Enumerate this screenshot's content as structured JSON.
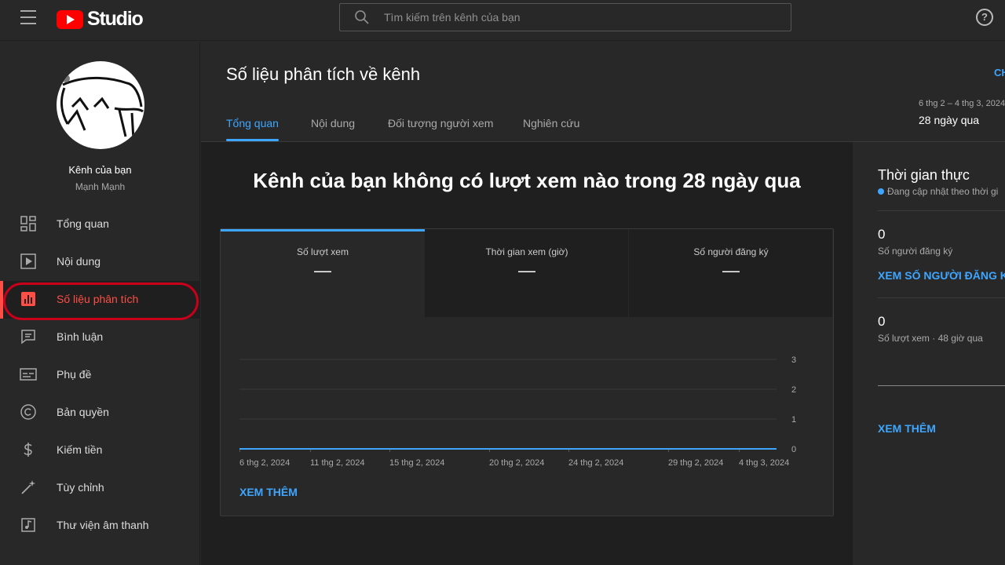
{
  "header": {
    "logo_text": "Studio",
    "search_placeholder": "Tìm kiếm trên kênh của bạn",
    "help_label": "?"
  },
  "sidebar": {
    "channel_name": "Kênh của bạn",
    "channel_owner": "Mạnh Mạnh",
    "items": [
      {
        "label": "Tổng quan",
        "icon": "dashboard-icon"
      },
      {
        "label": "Nội dung",
        "icon": "content-icon"
      },
      {
        "label": "Số liệu phân tích",
        "icon": "analytics-icon",
        "active": true
      },
      {
        "label": "Bình luận",
        "icon": "comments-icon"
      },
      {
        "label": "Phụ đề",
        "icon": "subtitles-icon"
      },
      {
        "label": "Bản quyền",
        "icon": "copyright-icon"
      },
      {
        "label": "Kiếm tiền",
        "icon": "monetization-icon"
      },
      {
        "label": "Tùy chỉnh",
        "icon": "customization-icon"
      },
      {
        "label": "Thư viện âm thanh",
        "icon": "audio-library-icon"
      }
    ]
  },
  "main": {
    "title": "Số liệu phân tích về kênh",
    "customize_link": "CH",
    "tabs": [
      "Tổng quan",
      "Nội dung",
      "Đối tượng người xem",
      "Nghiên cứu"
    ],
    "date_range": "6 thg 2 – 4 thg 3, 2024",
    "date_period": "28 ngày qua",
    "headline": "Kênh của bạn không có lượt xem nào trong 28 ngày qua",
    "metrics": [
      {
        "label": "Số lượt xem",
        "value": "—",
        "active": true
      },
      {
        "label": "Thời gian xem (giờ)",
        "value": "—"
      },
      {
        "label": "Số người đăng ký",
        "value": "—"
      }
    ],
    "see_more": "XEM THÊM"
  },
  "chart_data": {
    "type": "line",
    "x": [
      "6 thg 2, 2024",
      "11 thg 2, 2024",
      "15 thg 2, 2024",
      "20 thg 2, 2024",
      "24 thg 2, 2024",
      "29 thg 2, 2024",
      "4 thg 3, 2024"
    ],
    "yticks": [
      "0",
      "1",
      "2",
      "3"
    ],
    "ylim": [
      0,
      3
    ],
    "series": [
      {
        "values": [
          0,
          0,
          0,
          0,
          0,
          0,
          0
        ]
      }
    ],
    "line_color": "#3ea6ff",
    "grid": true
  },
  "realtime": {
    "title": "Thời gian thực",
    "subtitle": "Đang cập nhật theo thời gi",
    "subscribers_value": "0",
    "subscribers_label": "Số người đăng ký",
    "subscribers_link": "XEM SỐ NGƯỜI ĐĂNG KÝ",
    "views_value": "0",
    "views_label": "Số lượt xem · 48 giờ qua",
    "see_more": "XEM THÊM"
  },
  "colors": {
    "accent": "#3ea6ff",
    "active_nav": "#ff4e45",
    "highlight_ring": "#c8001a",
    "brand": "#ff0000"
  }
}
